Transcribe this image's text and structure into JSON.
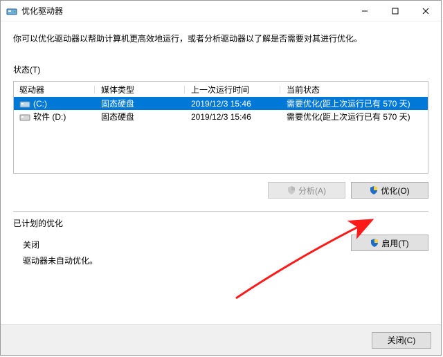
{
  "window": {
    "title": "优化驱动器"
  },
  "description": "你可以优化驱动器以帮助计算机更高效地运行，或者分析驱动器以了解是否需要对其进行优化。",
  "status_label": "状态(T)",
  "table": {
    "headers": {
      "drive": "驱动器",
      "media": "媒体类型",
      "last_run": "上一次运行时间",
      "current": "当前状态"
    },
    "rows": [
      {
        "name": "(C:)",
        "media": "固态硬盘",
        "last": "2019/12/3 15:46",
        "status": "需要优化(距上次运行已有 570 天)",
        "selected": true
      },
      {
        "name": "软件 (D:)",
        "media": "固态硬盘",
        "last": "2019/12/3 15:46",
        "status": "需要优化(距上次运行已有 570 天)",
        "selected": false
      }
    ]
  },
  "buttons": {
    "analyze": "分析(A)",
    "optimize": "优化(O)",
    "enable": "启用(T)",
    "close": "关闭(C)"
  },
  "scheduled": {
    "heading": "已计划的优化",
    "status": "关闭",
    "note": "驱动器未自动优化。"
  }
}
